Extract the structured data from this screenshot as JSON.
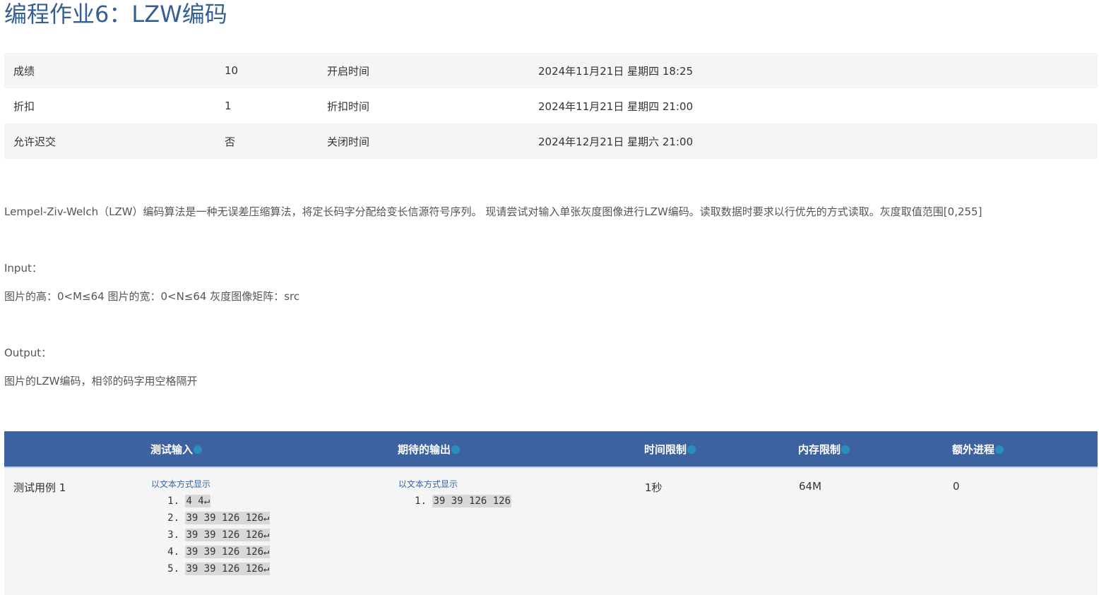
{
  "page": {
    "title": "编程作业6：LZW编码"
  },
  "info_rows": [
    {
      "label1": "成绩",
      "value1": "10",
      "label2": "开启时间",
      "value2": "2024年11月21日 星期四 18:25"
    },
    {
      "label1": "折扣",
      "value1": "1",
      "label2": "折扣时间",
      "value2": "2024年11月21日 星期四 21:00"
    },
    {
      "label1": "允许迟交",
      "value1": "否",
      "label2": "关闭时间",
      "value2": "2024年12月21日 星期六 21:00"
    }
  ],
  "description": {
    "intro": "Lempel-Ziv-Welch（LZW）编码算法是一种无误差压缩算法，将定长码字分配给变长信源符号序列。 现请尝试对输入单张灰度图像进行LZW编码。读取数据时要求以行优先的方式读取。灰度取值范围[0,255]",
    "input_heading": "Input：",
    "input_text": "图片的高：0<M≤64 图片的宽：0<N≤64 灰度图像矩阵：src",
    "output_heading": "Output：",
    "output_text": "图片的LZW编码，相邻的码字用空格隔开"
  },
  "test_table": {
    "headers": [
      "测试输入",
      "期待的输出",
      "时间限制",
      "内存限制",
      "额外进程"
    ],
    "help_icon": "help-circle-icon",
    "accent_color": "#3C62A0",
    "rows": [
      {
        "name": "测试用例 1",
        "show_text_label": "以文本方式显示",
        "input_lines": [
          {
            "num": "1.",
            "code": "4 4↵"
          },
          {
            "num": "2.",
            "code": "39 39 126 126↵"
          },
          {
            "num": "3.",
            "code": "39 39 126 126↵"
          },
          {
            "num": "4.",
            "code": "39 39 126 126↵"
          },
          {
            "num": "5.",
            "code": "39 39 126 126↵"
          }
        ],
        "output_show_text_label": "以文本方式显示",
        "output_lines": [
          {
            "num": "1.",
            "code": "39 39 126 126 "
          }
        ],
        "time_limit": "1秒",
        "memory_limit": "64M",
        "extra_process": "0"
      }
    ]
  }
}
